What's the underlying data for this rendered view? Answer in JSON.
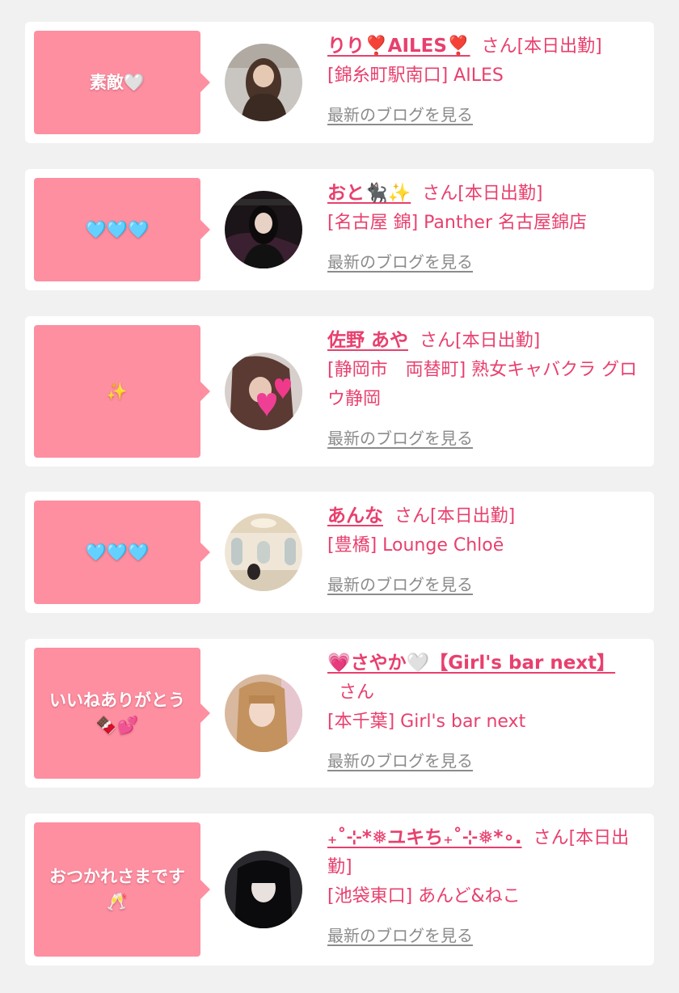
{
  "colors": {
    "background": "#f1f1f1",
    "card": "#ffffff",
    "bubble": "#fd8fa1",
    "accent_text": "#e8406e",
    "blog_link": "#8b8b8b"
  },
  "entries": [
    {
      "message": "素敵🤍",
      "name": "りり❣️AILES❣️",
      "suffix": "さん[本日出勤]",
      "shop": "[錦糸町駅南口] AILES",
      "blog_link": "最新のブログを見る",
      "avatar_icon": "avatar-brown-hair"
    },
    {
      "message": "🩵🩵🩵",
      "name": "おと🐈‍⬛✨",
      "suffix": "さん[本日出勤]",
      "shop": "[名古屋 錦] Panther 名古屋錦店",
      "blog_link": "最新のブログを見る",
      "avatar_icon": "avatar-dark-hair"
    },
    {
      "message": "✨",
      "name": "佐野 あや",
      "suffix": "さん[本日出勤]",
      "shop": "[静岡市　両替町] 熟女キャバクラ グロウ静岡",
      "blog_link": "最新のブログを見る",
      "avatar_icon": "avatar-heart-sticker"
    },
    {
      "message": "🩵🩵🩵",
      "name": "あんな",
      "suffix": "さん[本日出勤]",
      "shop": "[豊橋] Lounge Chloē",
      "blog_link": "最新のブログを見る",
      "avatar_icon": "avatar-lounge-room"
    },
    {
      "message": "いいねありがとう🍫💕",
      "name": "💗さやか🤍【Girl's bar next】",
      "suffix": "さん",
      "shop": "[本千葉] Girl's bar next",
      "blog_link": "最新のブログを見る",
      "avatar_icon": "avatar-blonde-hair"
    },
    {
      "message": "おつかれさまです🥂",
      "name": "₊˚⊹*❅ユキち₊˚⊹❅*∘.",
      "suffix": "さん[本日出勤]",
      "shop": "[池袋東口] あんど&ねこ",
      "blog_link": "最新のブログを見る",
      "avatar_icon": "avatar-black-hair"
    }
  ]
}
